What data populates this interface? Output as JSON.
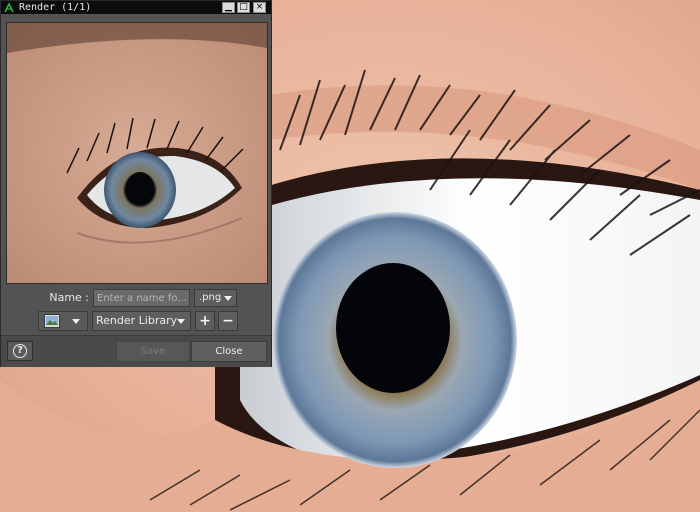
{
  "window": {
    "title": "Render (1/1)",
    "app_icon": "daz-studio-icon",
    "minimize_label": "▁",
    "maximize_label": "□",
    "close_label": "×"
  },
  "form": {
    "name_label": "Name :",
    "name_value": "",
    "name_placeholder": "Enter a name fo...",
    "format_value": ".png",
    "destination_value": "Render Library",
    "add_label": "+",
    "remove_label": "−",
    "image_icon": "image-icon"
  },
  "footer": {
    "help_label": "?",
    "save_label": "Save",
    "close_label": "Close"
  }
}
